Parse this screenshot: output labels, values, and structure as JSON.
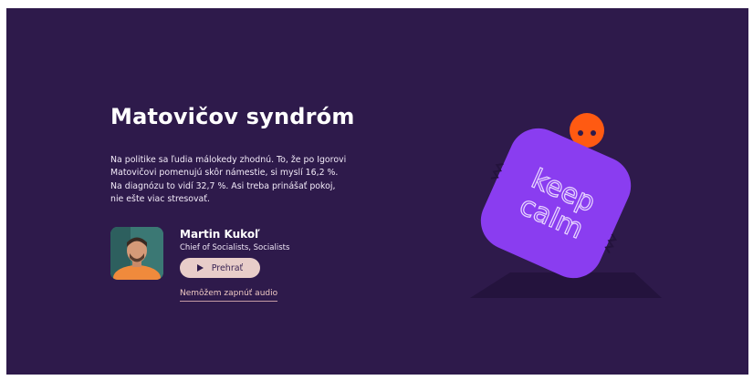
{
  "hero": {
    "title": "Matovičov syndróm",
    "description": "Na politike sa ľudia málokedy zhodnú. To, že po Igorovi Matovičovi pomenujú skôr námestie, si myslí 16,2 %. Na diagnózu to vidí 32,7 %. Asi treba prinášať pokoj, nie ešte viac stresovať."
  },
  "person": {
    "name": "Martin Kukoľ",
    "role": "Chief of Socialists, Socialists",
    "avatar_icon": "portrait-avatar"
  },
  "audio": {
    "play_label": "Prehrať",
    "play_icon": "play-icon",
    "cant_play_label": "Nemôžem zapnúť audio"
  },
  "illustration": {
    "text_line1": "keep",
    "text_line2": "calm"
  },
  "colors": {
    "background": "#2e1a4b",
    "accent_purple": "#8a3df0",
    "accent_orange": "#ff5a12",
    "button": "#e8cdc9"
  }
}
